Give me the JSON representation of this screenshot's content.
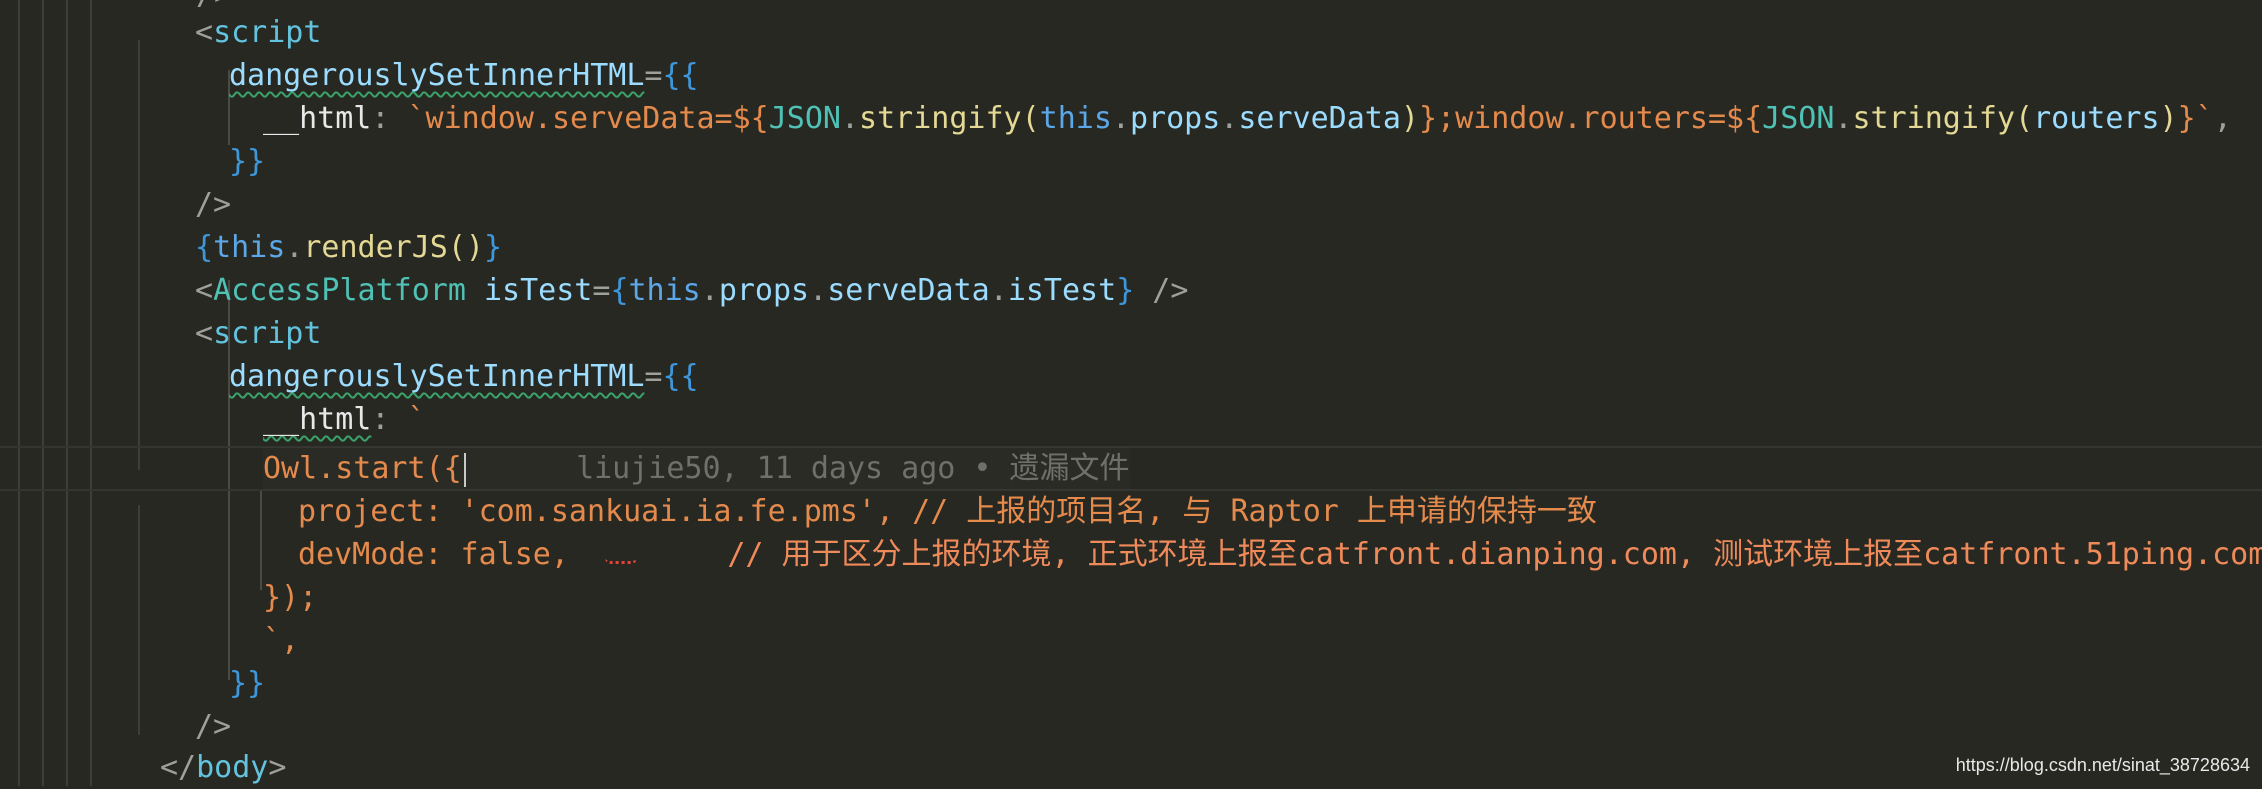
{
  "editor": {
    "lines": [
      {
        "punc_open": "<",
        "tag": "script"
      },
      {
        "attr": "dangerouslySetInnerHTML",
        "eq": "=",
        "open": "{{"
      },
      {
        "key": "__html",
        "colon": ": ",
        "str1": "`window.serveData=${",
        "cls1": "JSON",
        "dot1": ".",
        "fn1": "stringify",
        "paren1": "(",
        "this1": "this",
        "dot2": ".",
        "prop1": "props",
        "dot3": ".",
        "prop2": "serveData",
        "paren2": ")",
        "str2": "};window.routers=${",
        "cls2": "JSON",
        "dot4": ".",
        "fn2": "stringify",
        "paren3": "(",
        "prop3": "routers",
        "paren4": ")",
        "str3": "}`",
        "comma": ","
      },
      {
        "close": "}}"
      },
      {
        "punc": "/>"
      },
      {
        "open": "{",
        "this": "this",
        "dot": ".",
        "fn": "renderJS",
        "parens": "()",
        "close": "}"
      },
      {
        "punc_open": "<",
        "cls": "AccessPlatform",
        "attr": "isTest",
        "eq": "=",
        "open": "{",
        "this": "this",
        "dot1": ".",
        "prop1": "props",
        "dot2": ".",
        "prop2": "serveData",
        "dot3": ".",
        "prop3": "isTest",
        "close": "}",
        "end": " />"
      },
      {
        "punc_open": "<",
        "tag": "script"
      },
      {
        "attr": "dangerouslySetInnerHTML",
        "eq": "=",
        "open": "{{"
      },
      {
        "key": "__html",
        "colon": ": ",
        "str": "`"
      },
      {
        "code": "Owl.start({",
        "blame": "liujie50, 11 days ago • 遗漏文件"
      },
      {
        "code": "project: 'com.sankuai.ia.fe.pms', // 上报的项目名, 与 Raptor 上申请的保持一致"
      },
      {
        "code": "devMode: false,",
        "comment": "// 用于区分上报的环境, 正式环境上报至catfront.dianping.com, 测试环境上报至catfront.51ping.com"
      },
      {
        "code": "});"
      },
      {
        "code": "`,"
      },
      {
        "close": "}}"
      },
      {
        "punc": "/>"
      },
      {
        "punc_open": "</",
        "tag": "body",
        "punc_close": ">"
      }
    ]
  },
  "watermark": "https://blog.csdn.net/sinat_38728634",
  "colors": {
    "background": "#272822",
    "tag": "#63c3df",
    "string": "#e48a4c",
    "brace": "#3e97db",
    "comment": "#ef8a5a"
  }
}
